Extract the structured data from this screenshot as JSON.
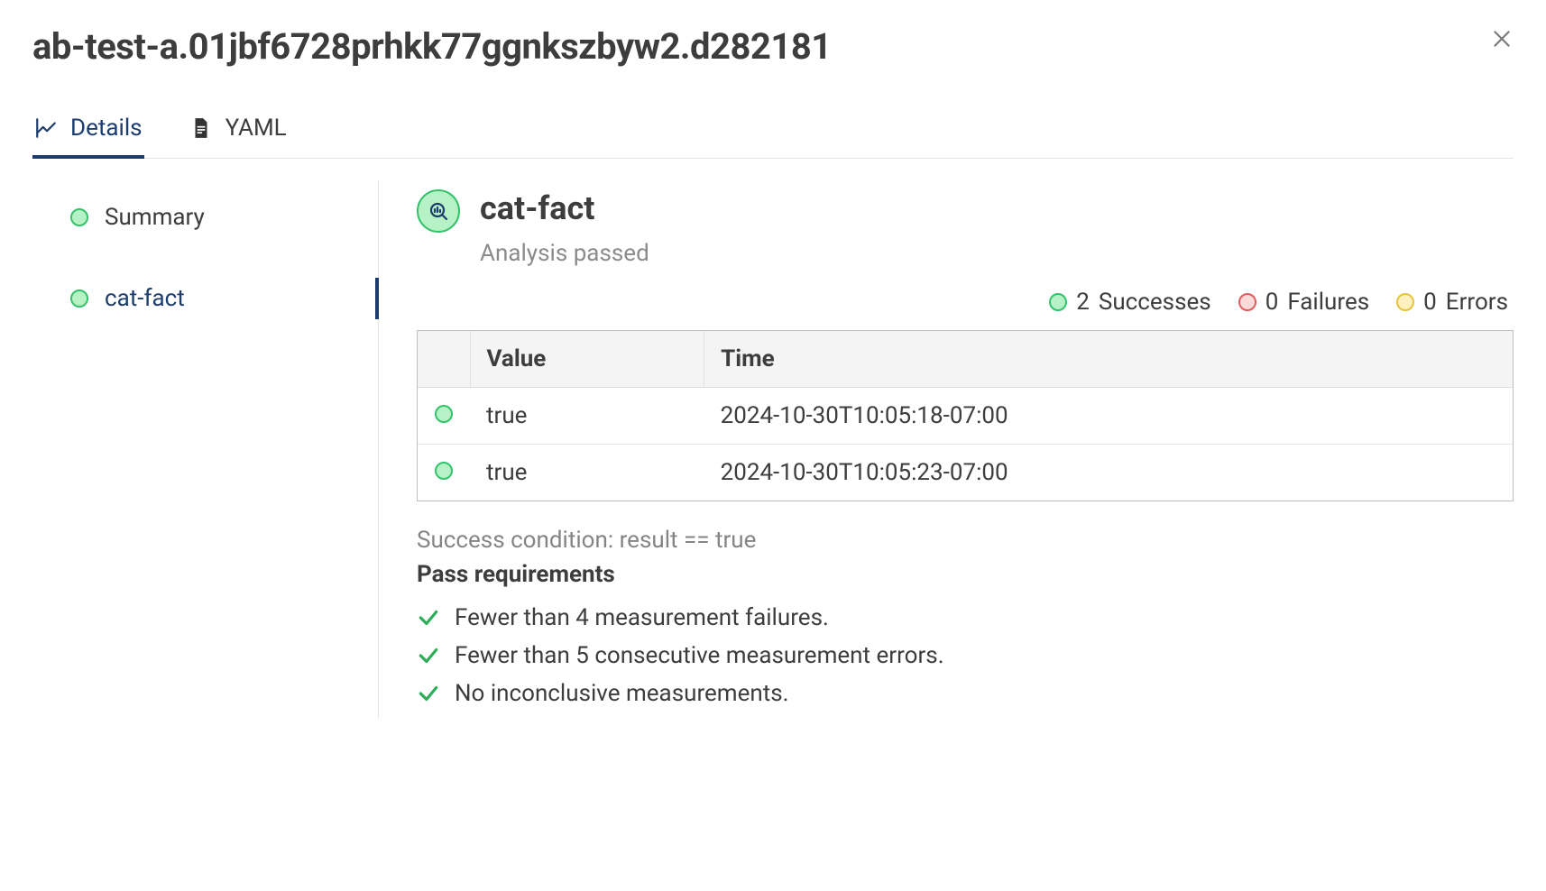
{
  "header": {
    "title": "ab-test-a.01jbf6728prhkk77ggnkszbyw2.d282181"
  },
  "tabs": [
    {
      "id": "details",
      "label": "Details",
      "active": true
    },
    {
      "id": "yaml",
      "label": "YAML",
      "active": false
    }
  ],
  "sidebar": {
    "items": [
      {
        "id": "summary",
        "label": "Summary",
        "status": "success",
        "selected": false
      },
      {
        "id": "cat-fact",
        "label": "cat-fact",
        "status": "success",
        "selected": true
      }
    ]
  },
  "main": {
    "title": "cat-fact",
    "subtitle": "Analysis passed",
    "stats": {
      "successes": {
        "count": 2,
        "label": "Successes"
      },
      "failures": {
        "count": 0,
        "label": "Failures"
      },
      "errors": {
        "count": 0,
        "label": "Errors"
      }
    },
    "table": {
      "columns": {
        "value": "Value",
        "time": "Time"
      },
      "rows": [
        {
          "status": "success",
          "value": "true",
          "time": "2024-10-30T10:05:18-07:00"
        },
        {
          "status": "success",
          "value": "true",
          "time": "2024-10-30T10:05:23-07:00"
        }
      ]
    },
    "condition_label": "Success condition:",
    "condition_expr": "result == true",
    "requirements_title": "Pass requirements",
    "requirements": [
      "Fewer than 4 measurement failures.",
      "Fewer than 5 consecutive measurement errors.",
      "No inconclusive measurements."
    ]
  }
}
